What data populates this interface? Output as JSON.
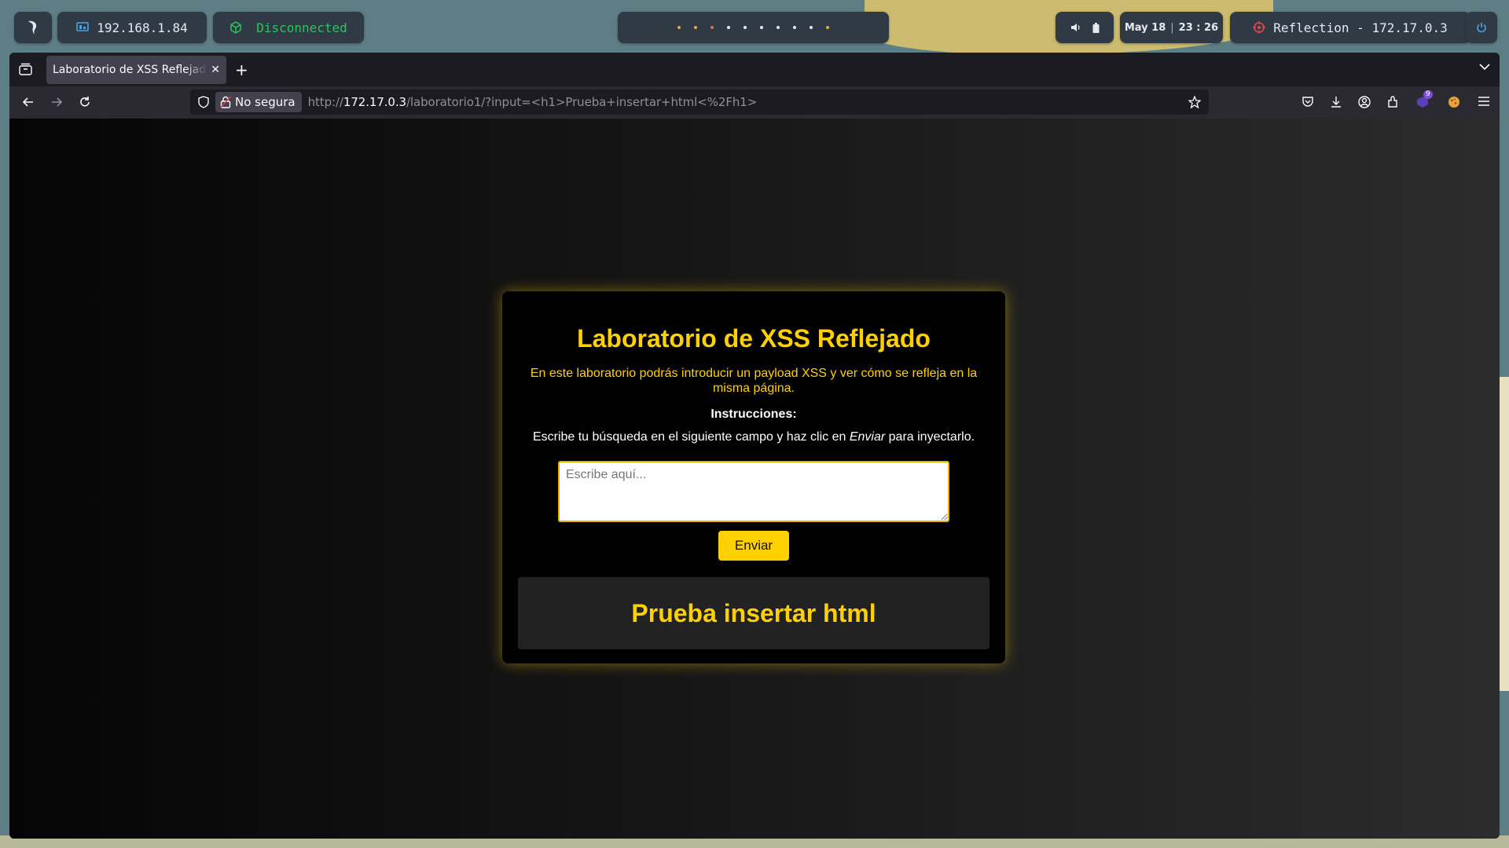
{
  "topbar": {
    "ip_address": "192.168.1.84",
    "vpn_status": "Disconnected",
    "date": "May 18",
    "time": "23 : 26",
    "target": "Reflection - 172.17.0.3",
    "colors": {
      "vpn": "#2ec25e",
      "ip_icon": "#4aa3e8",
      "target_icon": "#e0454a",
      "power_icon": "#4aa3e8"
    }
  },
  "browser": {
    "tab_title": "Laboratorio de XSS Reflejado",
    "security_label": "No segura",
    "url": {
      "scheme": "http://",
      "host": "172.17.0.3",
      "path": "/laboratorio1/?input=<h1>Prueba+insertar+html<%2Fh1>"
    },
    "extensions_badge": "9"
  },
  "page": {
    "title": "Laboratorio de XSS Reflejado",
    "description": "En este laboratorio podrás introducir un payload XSS y ver cómo se refleja en la misma página.",
    "instructions_title": "Instrucciones:",
    "instructions_prefix": "Escribe tu búsqueda en el siguiente campo y haz clic en ",
    "instructions_emphasis": "Enviar",
    "instructions_suffix": " para inyectarlo.",
    "input_placeholder": "Escribe aquí...",
    "submit_label": "Enviar",
    "reflected_output": "Prueba insertar html",
    "accent_color": "#ffd000"
  }
}
